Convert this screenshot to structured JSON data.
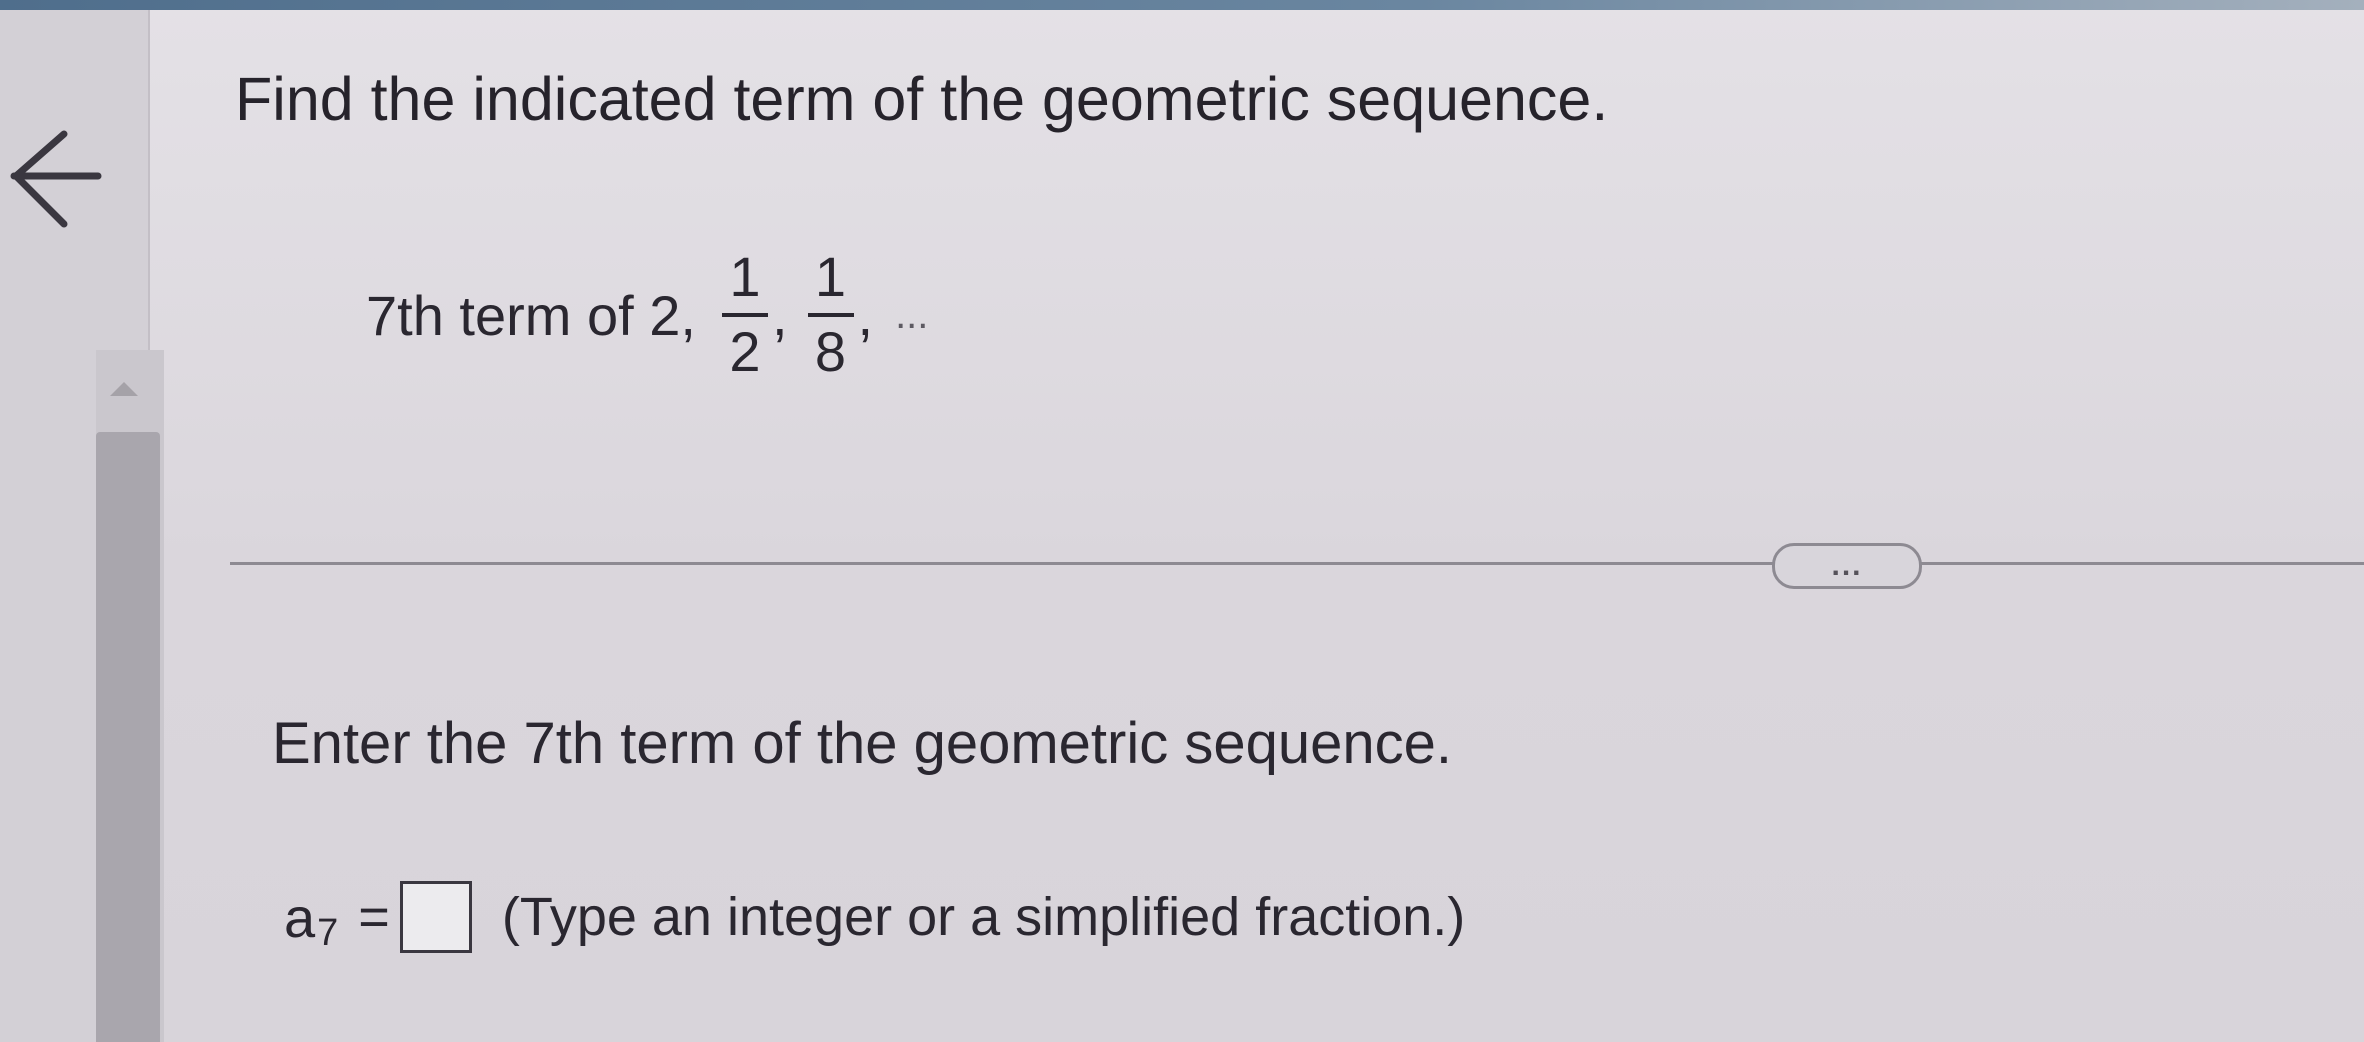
{
  "question": {
    "title": "Find the indicated term of the geometric sequence."
  },
  "problem": {
    "prefix": "7th term of 2,",
    "terms": [
      {
        "numerator": "1",
        "denominator": "2"
      },
      {
        "numerator": "1",
        "denominator": "8"
      }
    ],
    "separator": ",",
    "ellipsis": "..."
  },
  "toolbar": {
    "more_label": "..."
  },
  "answer": {
    "prompt": "Enter the 7th term of the geometric sequence.",
    "variable": "a",
    "subscript": "7",
    "equals": "=",
    "value": "",
    "hint": "(Type an integer or a simplified fraction.)"
  },
  "icons": {
    "back": "left-arrow-icon"
  },
  "colors": {
    "background": "#dcd8de",
    "text": "#2a2730",
    "divider": "#8d8a92",
    "scrollbar_thumb": "#a9a6ad"
  }
}
